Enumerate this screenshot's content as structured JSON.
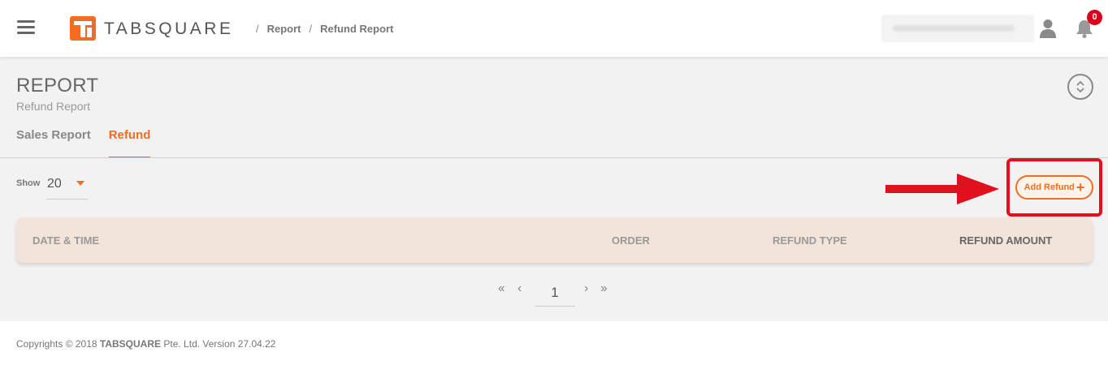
{
  "header": {
    "logo_text": "TABSQUARE",
    "breadcrumb": [
      "Report",
      "Refund Report"
    ],
    "notification_count": "0"
  },
  "page": {
    "title": "REPORT",
    "subtitle": "Refund Report"
  },
  "tabs": [
    {
      "label": "Sales Report",
      "active": false
    },
    {
      "label": "Refund",
      "active": true
    }
  ],
  "controls": {
    "show_label": "Show",
    "show_value": "20",
    "add_refund_label": "Add Refund"
  },
  "table": {
    "columns": [
      "DATE & TIME",
      "ORDER",
      "REFUND TYPE",
      "REFUND AMOUNT"
    ]
  },
  "pagination": {
    "first": "«",
    "prev": "‹",
    "current": "1",
    "next": "›",
    "last": "»"
  },
  "footer": {
    "prefix": "Copyrights © 2018",
    "company": "TABSQUARE",
    "suffix": "Pte. Ltd. Version 27.04.22"
  },
  "colors": {
    "accent": "#f26c22",
    "highlight": "#e0101c",
    "table_header_bg": "#f2e4d9"
  },
  "icons": [
    "menu-icon",
    "user-icon",
    "bell-icon",
    "collapse-icon",
    "caret-down-icon",
    "plus-icon",
    "arrow-right-icon"
  ]
}
